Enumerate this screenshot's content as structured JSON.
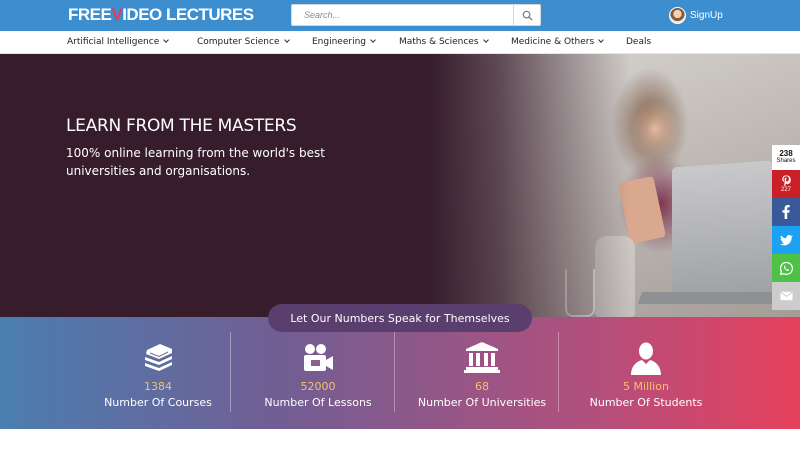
{
  "header": {
    "logo_part1": "FREE",
    "logo_v": "V",
    "logo_part2": "IDEO LECTURES",
    "search_placeholder": "Search...",
    "search_icon": "search-icon",
    "signup_label": "SignUp",
    "brand_color": "#3d8ecf"
  },
  "nav": {
    "items": [
      {
        "label": "Artificial Intelligence",
        "has_dropdown": true
      },
      {
        "label": "Computer Science",
        "has_dropdown": true
      },
      {
        "label": "Engineering",
        "has_dropdown": true
      },
      {
        "label": "Maths & Sciences",
        "has_dropdown": true
      },
      {
        "label": "Medicine & Others",
        "has_dropdown": true
      },
      {
        "label": "Deals",
        "has_dropdown": false
      }
    ]
  },
  "hero": {
    "title": "LEARN FROM THE MASTERS",
    "subtitle": "100% online learning from the world's best universities and organisations.",
    "background_color": "#371d2c"
  },
  "share": {
    "count": "238",
    "count_label": "Shares",
    "pinterest_count": "227",
    "buttons": [
      {
        "icon": "pinterest-icon",
        "color": "#cb2027"
      },
      {
        "icon": "facebook-icon",
        "color": "#3b5998"
      },
      {
        "icon": "twitter-icon",
        "color": "#1da1f2"
      },
      {
        "icon": "whatsapp-icon",
        "color": "#4dc247"
      },
      {
        "icon": "email-icon",
        "color": "#cccccc"
      }
    ]
  },
  "stats": {
    "heading": "Let Our Numbers Speak for Themselves",
    "items": [
      {
        "value": "1384",
        "label": "Number Of Courses",
        "icon": "books-icon"
      },
      {
        "value": "52000",
        "label": "Number Of Lessons",
        "icon": "video-camera-icon"
      },
      {
        "value": "68",
        "label": "Number Of Universities",
        "icon": "university-icon"
      },
      {
        "value": "5 Million",
        "label": "Number Of Students",
        "icon": "student-icon"
      }
    ],
    "value_color": "#f5c16b"
  }
}
